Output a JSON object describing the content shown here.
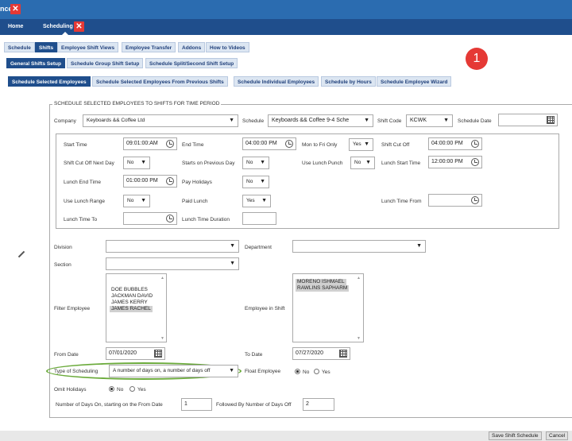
{
  "window": {
    "title_fragment": "nce"
  },
  "nav": {
    "home": "Home",
    "scheduling": "Scheduling"
  },
  "tabs1": [
    "Schedule",
    "Shifts",
    "Employee Shift Views",
    "Employee Transfer",
    "Addons",
    "How to Videos"
  ],
  "tabs2": [
    "General Shifts Setup",
    "Schedule Group Shift Setup",
    "Schedule Split/Second Shift Setup"
  ],
  "tabs3": [
    "Schedule Selected Employees",
    "Schedule Selected Employees From Previous Shifts",
    "Schedule Individual Employees",
    "Schedule by Hours",
    "Schedule Employee Wizard"
  ],
  "badge": "1",
  "form": {
    "legend": "SCHEDULE SELECTED EMPLOYEES TO SHIFTS FOR TIME PERIOD",
    "company_label": "Company",
    "company_value": "Keyboards && Coffee Ltd",
    "schedule_label": "Schedule",
    "schedule_value": "Keyboards && Coffee 9-4 Sche",
    "shift_code_label": "Shift Code",
    "shift_code_value": "KCWK",
    "schedule_date_label": "Schedule Date",
    "start_time_label": "Start Time",
    "start_time_value": "09:01:00:AM",
    "end_time_label": "End Time",
    "end_time_value": "04:00:00 PM",
    "mon_fri_label": "Mon to Fri Only",
    "mon_fri_value": "Yes",
    "shift_cutoff_label": "Shift Cut Off",
    "shift_cutoff_value": "04:00:00 PM",
    "cutoff_next_label": "Shift Cut Off Next Day",
    "cutoff_next_value": "No",
    "starts_prev_label": "Starts on Previous Day",
    "starts_prev_value": "No",
    "use_lunch_punch_label": "Use Lunch Punch",
    "use_lunch_punch_value": "No",
    "lunch_start_label": "Lunch Start Time",
    "lunch_start_value": "12:00:00 PM",
    "lunch_end_label": "Lunch End Time",
    "lunch_end_value": "01:00:00 PM",
    "pay_holidays_label": "Pay Holidays",
    "pay_holidays_value": "No",
    "use_lunch_range_label": "Use Lunch Range",
    "use_lunch_range_value": "No",
    "paid_lunch_label": "Paid Lunch",
    "paid_lunch_value": "Yes",
    "lunch_from_label": "Lunch Time From",
    "lunch_to_label": "Lunch Time To",
    "lunch_duration_label": "Lunch Time Duration",
    "division_label": "Division",
    "department_label": "Department",
    "section_label": "Section",
    "filter_employee_label": "Filter Employee",
    "filter_employees": [
      "DOE BUBBLES",
      "JACKMAN DAVID",
      "JAMES KERRY",
      "JAMES RACHEL"
    ],
    "employee_in_shift_label": "Employee in Shift",
    "employees_in_shift": [
      "MORENO ISHMAEL",
      "RAWLINS SAPHARM"
    ],
    "from_date_label": "From Date",
    "from_date_value": "07/01/2020",
    "to_date_label": "To Date",
    "to_date_value": "07/27/2020",
    "type_sched_label": "Type of Scheduling",
    "type_sched_value": "A number of days on, a number of days off",
    "float_label": "Float Employee",
    "float_no": "No",
    "float_yes": "Yes",
    "omit_label": "Omit Holidays",
    "omit_no": "No",
    "omit_yes": "Yes",
    "days_on_label": "Number of Days On, starting on the From Date",
    "days_on_value": "1",
    "days_off_label": "Followed By Number of Days Off",
    "days_off_value": "2"
  },
  "buttons": {
    "save": "Save Shift Schedule",
    "cancel": "Cancel"
  }
}
